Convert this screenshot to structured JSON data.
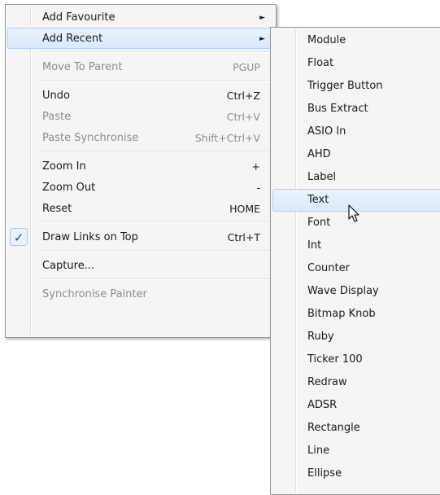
{
  "main_menu": {
    "items": [
      {
        "label": "Add Favourite",
        "has_submenu": true
      },
      {
        "label": "Add Recent",
        "has_submenu": true,
        "highlighted": true
      },
      {
        "label": "Move To Parent",
        "shortcut": "PGUP",
        "disabled": true
      },
      {
        "label": "Undo",
        "shortcut": "Ctrl+Z"
      },
      {
        "label": "Paste",
        "shortcut": "Ctrl+V",
        "disabled": true
      },
      {
        "label": "Paste Synchronise",
        "shortcut": "Shift+Ctrl+V",
        "disabled": true
      },
      {
        "label": "Zoom In",
        "shortcut": "+"
      },
      {
        "label": "Zoom Out",
        "shortcut": "-"
      },
      {
        "label": "Reset",
        "shortcut": "HOME"
      },
      {
        "label": "Draw Links on Top",
        "shortcut": "Ctrl+T",
        "checked": true,
        "check_glyph": "✓"
      },
      {
        "label": "Capture..."
      },
      {
        "label": "Synchronise Painter",
        "disabled": true
      }
    ],
    "submenu_arrow": "►"
  },
  "recent_submenu": {
    "items": [
      {
        "label": "Module"
      },
      {
        "label": "Float"
      },
      {
        "label": "Trigger Button"
      },
      {
        "label": "Bus Extract"
      },
      {
        "label": "ASIO In"
      },
      {
        "label": "AHD"
      },
      {
        "label": "Label"
      },
      {
        "label": "Text",
        "highlighted": true
      },
      {
        "label": "Font"
      },
      {
        "label": "Int"
      },
      {
        "label": "Counter"
      },
      {
        "label": "Wave Display"
      },
      {
        "label": "Bitmap Knob"
      },
      {
        "label": "Ruby"
      },
      {
        "label": "Ticker 100"
      },
      {
        "label": "Redraw"
      },
      {
        "label": "ADSR"
      },
      {
        "label": "Rectangle"
      },
      {
        "label": "Line"
      },
      {
        "label": "Ellipse"
      }
    ]
  },
  "colors": {
    "highlight_border": "#aecff7",
    "highlight_fill": "#dcebfc",
    "disabled_text": "#8c8c8c",
    "menu_background": "#f5f5f5"
  }
}
